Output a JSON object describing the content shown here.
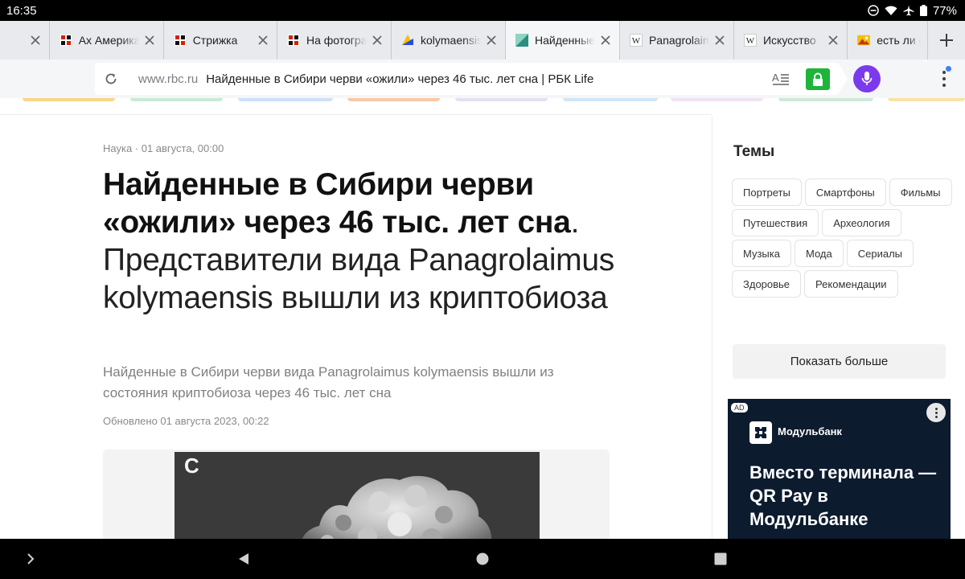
{
  "status_bar": {
    "time": "16:35",
    "battery": "77%",
    "icons": [
      "do-not-disturb-icon",
      "wifi-icon",
      "airplane-icon",
      "battery-icon"
    ]
  },
  "tabs": [
    {
      "title": "",
      "favicon": "globe-icon",
      "active": false
    },
    {
      "title": "Ах Америка",
      "favicon": "rbc-favicon",
      "active": false
    },
    {
      "title": "Стрижка",
      "favicon": "rbc-favicon",
      "active": false
    },
    {
      "title": "На фотографии",
      "favicon": "rbc-favicon",
      "active": false
    },
    {
      "title": "kolymaensis",
      "favicon": "yandex-favicon",
      "active": false
    },
    {
      "title": "Найденные",
      "favicon": "rbc-life-favicon",
      "active": true
    },
    {
      "title": "Panagrolaimus",
      "favicon": "wikipedia-favicon",
      "active": false
    },
    {
      "title": "Искусство",
      "favicon": "wikipedia-favicon",
      "active": false
    },
    {
      "title": "есть ли с",
      "favicon": "yandex-images-favicon",
      "active": false
    }
  ],
  "address_bar": {
    "host": "www.rbc.ru",
    "title": "Найденные в Сибири черви «ожили» через 46 тыс. лет сна | РБК Life"
  },
  "article": {
    "meta": "Наука · 01 августа, 00:00",
    "headline_bold": "Найденные в Сибири черви «ожили» через 46 тыс. лет сна",
    "headline_light": ". Представители вида Panagrolaimus kolymaensis вышли из криптобиоза",
    "lead": "Найденные в Сибири черви вида Panagrolaimus kolymaensis вышли из состояния криптобиоза через 46 тыс. лет сна",
    "updated": "Обновлено 01 августа 2023, 00:22",
    "photo_label": "C"
  },
  "sidebar": {
    "topics_title": "Темы",
    "topics": [
      "Портреты",
      "Смартфоны",
      "Фильмы",
      "Путешествия",
      "Археология",
      "Музыка",
      "Мода",
      "Сериалы",
      "Здоровье",
      "Рекомендации"
    ],
    "show_more": "Показать больше"
  },
  "ad": {
    "badge": "AD",
    "brand": "Модульбанк",
    "headline": "Вместо терминала — QR Pay в Модульбанке"
  },
  "colors": {
    "mic": "#7c3aed",
    "lock": "#1eb53a",
    "ad_background": "#0c1b2e"
  }
}
